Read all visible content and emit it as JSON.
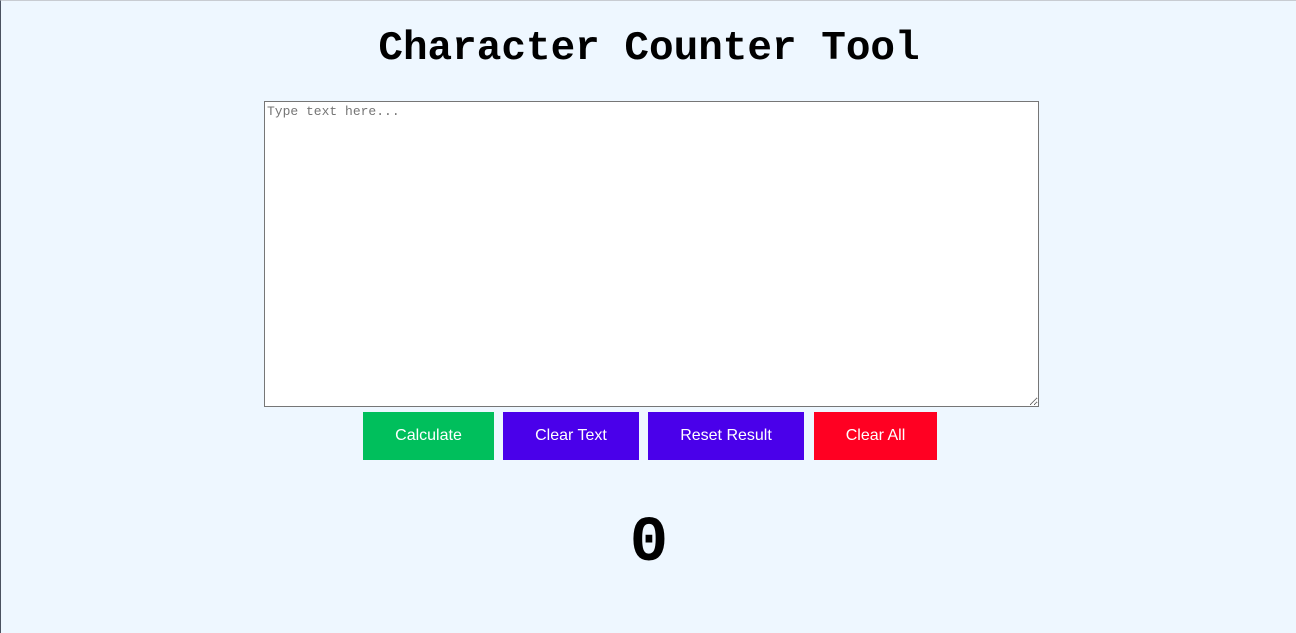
{
  "page": {
    "title": "Character Counter Tool",
    "background_color": "#eef7ff"
  },
  "input": {
    "value": "",
    "placeholder": "Type text here..."
  },
  "buttons": [
    {
      "label": "Calculate",
      "color": "#00bf5c"
    },
    {
      "label": "Clear Text",
      "color": "#4a00ea"
    },
    {
      "label": "Reset Result",
      "color": "#4a00ea"
    },
    {
      "label": "Clear All",
      "color": "#ff0022"
    }
  ],
  "result": {
    "value": "0"
  }
}
